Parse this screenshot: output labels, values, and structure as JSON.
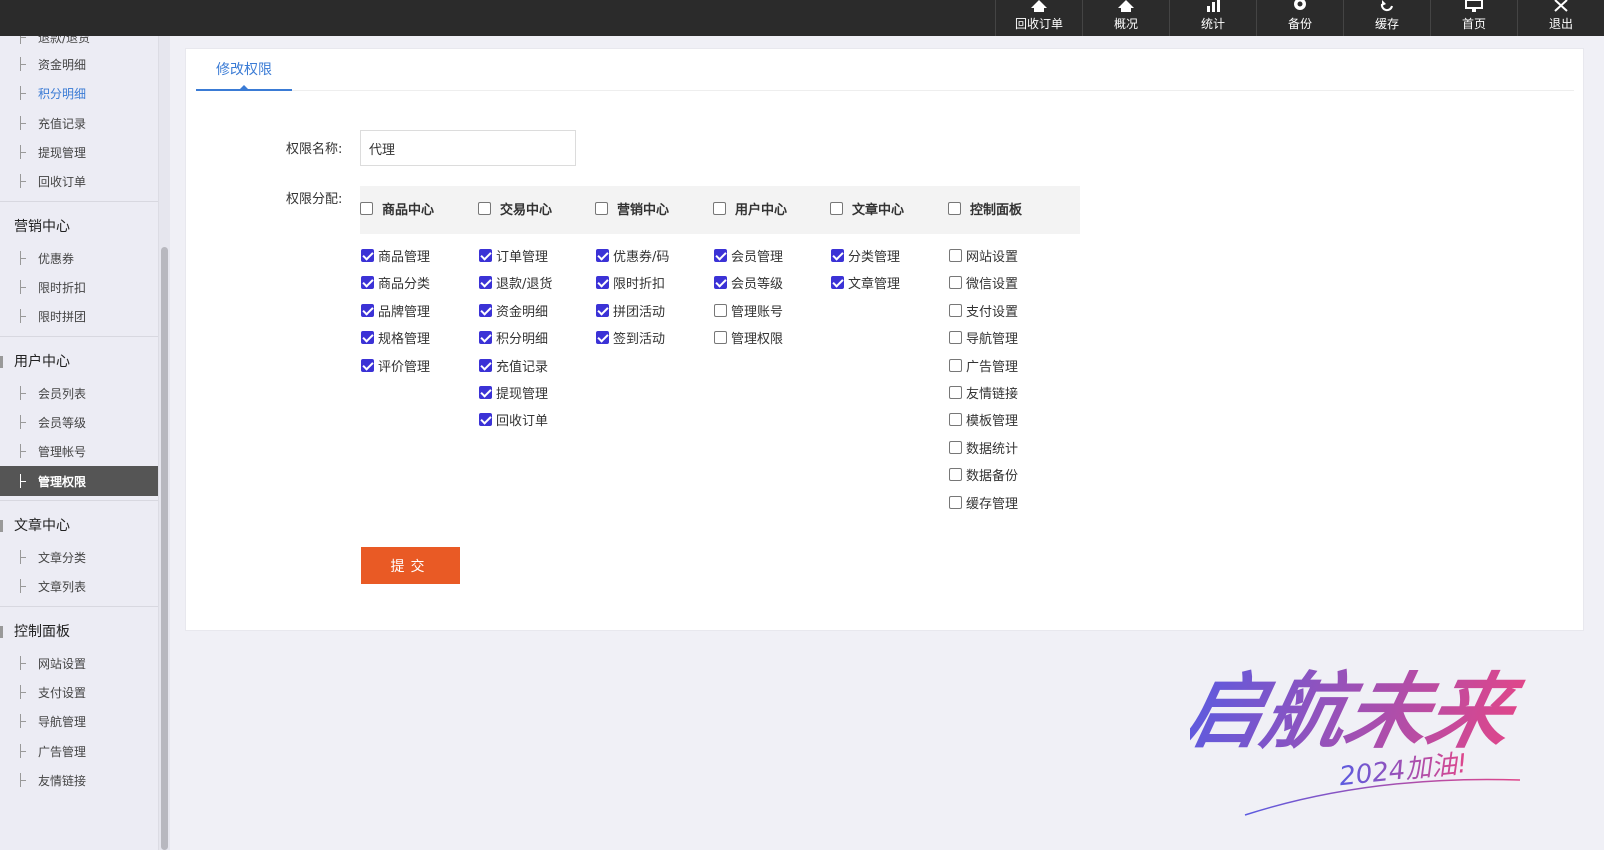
{
  "topnav": [
    {
      "label": "回收订单",
      "icon": "home-icon"
    },
    {
      "label": "概况",
      "icon": "home-icon"
    },
    {
      "label": "统计",
      "icon": "bar-chart-icon"
    },
    {
      "label": "备份",
      "icon": "gear-icon"
    },
    {
      "label": "缓存",
      "icon": "refresh-icon"
    },
    {
      "label": "首页",
      "icon": "monitor-icon"
    },
    {
      "label": "退出",
      "icon": "close-icon"
    }
  ],
  "sidebar": {
    "partial_top": "退款/退货",
    "trade_items": [
      "资金明细",
      "积分明细",
      "充值记录",
      "提现管理",
      "回收订单"
    ],
    "marketing": {
      "title": "营销中心",
      "items": [
        "优惠券",
        "限时折扣",
        "限时拼团"
      ]
    },
    "users": {
      "title": "用户中心",
      "items": [
        "会员列表",
        "会员等级",
        "管理帐号",
        "管理权限"
      ]
    },
    "articles": {
      "title": "文章中心",
      "items": [
        "文章分类",
        "文章列表"
      ]
    },
    "control": {
      "title": "控制面板",
      "items": [
        "网站设置",
        "支付设置",
        "导航管理",
        "广告管理",
        "友情链接"
      ]
    }
  },
  "tab": {
    "label": "修改权限"
  },
  "form": {
    "name_label": "权限名称:",
    "name_value": "代理",
    "assign_label": "权限分配:",
    "submit_label": "提交"
  },
  "permissions": [
    {
      "group": "商品中心",
      "checked": false,
      "items": [
        {
          "label": "商品管理",
          "checked": true
        },
        {
          "label": "商品分类",
          "checked": true
        },
        {
          "label": "品牌管理",
          "checked": true
        },
        {
          "label": "规格管理",
          "checked": true
        },
        {
          "label": "评价管理",
          "checked": true
        }
      ]
    },
    {
      "group": "交易中心",
      "checked": false,
      "items": [
        {
          "label": "订单管理",
          "checked": true
        },
        {
          "label": "退款/退货",
          "checked": true
        },
        {
          "label": "资金明细",
          "checked": true
        },
        {
          "label": "积分明细",
          "checked": true
        },
        {
          "label": "充值记录",
          "checked": true
        },
        {
          "label": "提现管理",
          "checked": true
        },
        {
          "label": "回收订单",
          "checked": true
        }
      ]
    },
    {
      "group": "营销中心",
      "checked": false,
      "items": [
        {
          "label": "优惠券/码",
          "checked": true
        },
        {
          "label": "限时折扣",
          "checked": true
        },
        {
          "label": "拼团活动",
          "checked": true
        },
        {
          "label": "签到活动",
          "checked": true
        }
      ]
    },
    {
      "group": "用户中心",
      "checked": false,
      "items": [
        {
          "label": "会员管理",
          "checked": true
        },
        {
          "label": "会员等级",
          "checked": true
        },
        {
          "label": "管理账号",
          "checked": false
        },
        {
          "label": "管理权限",
          "checked": false
        }
      ]
    },
    {
      "group": "文章中心",
      "checked": false,
      "items": [
        {
          "label": "分类管理",
          "checked": true
        },
        {
          "label": "文章管理",
          "checked": true
        }
      ]
    },
    {
      "group": "控制面板",
      "checked": false,
      "items": [
        {
          "label": "网站设置",
          "checked": false
        },
        {
          "label": "微信设置",
          "checked": false
        },
        {
          "label": "支付设置",
          "checked": false
        },
        {
          "label": "导航管理",
          "checked": false
        },
        {
          "label": "广告管理",
          "checked": false
        },
        {
          "label": "友情链接",
          "checked": false
        },
        {
          "label": "模板管理",
          "checked": false
        },
        {
          "label": "数据统计",
          "checked": false
        },
        {
          "label": "数据备份",
          "checked": false
        },
        {
          "label": "缓存管理",
          "checked": false
        }
      ]
    }
  ],
  "watermark": {
    "title": "启航未来",
    "subtitle": "2024加油!",
    "colors": [
      "#5b5be0",
      "#e0468a"
    ]
  }
}
